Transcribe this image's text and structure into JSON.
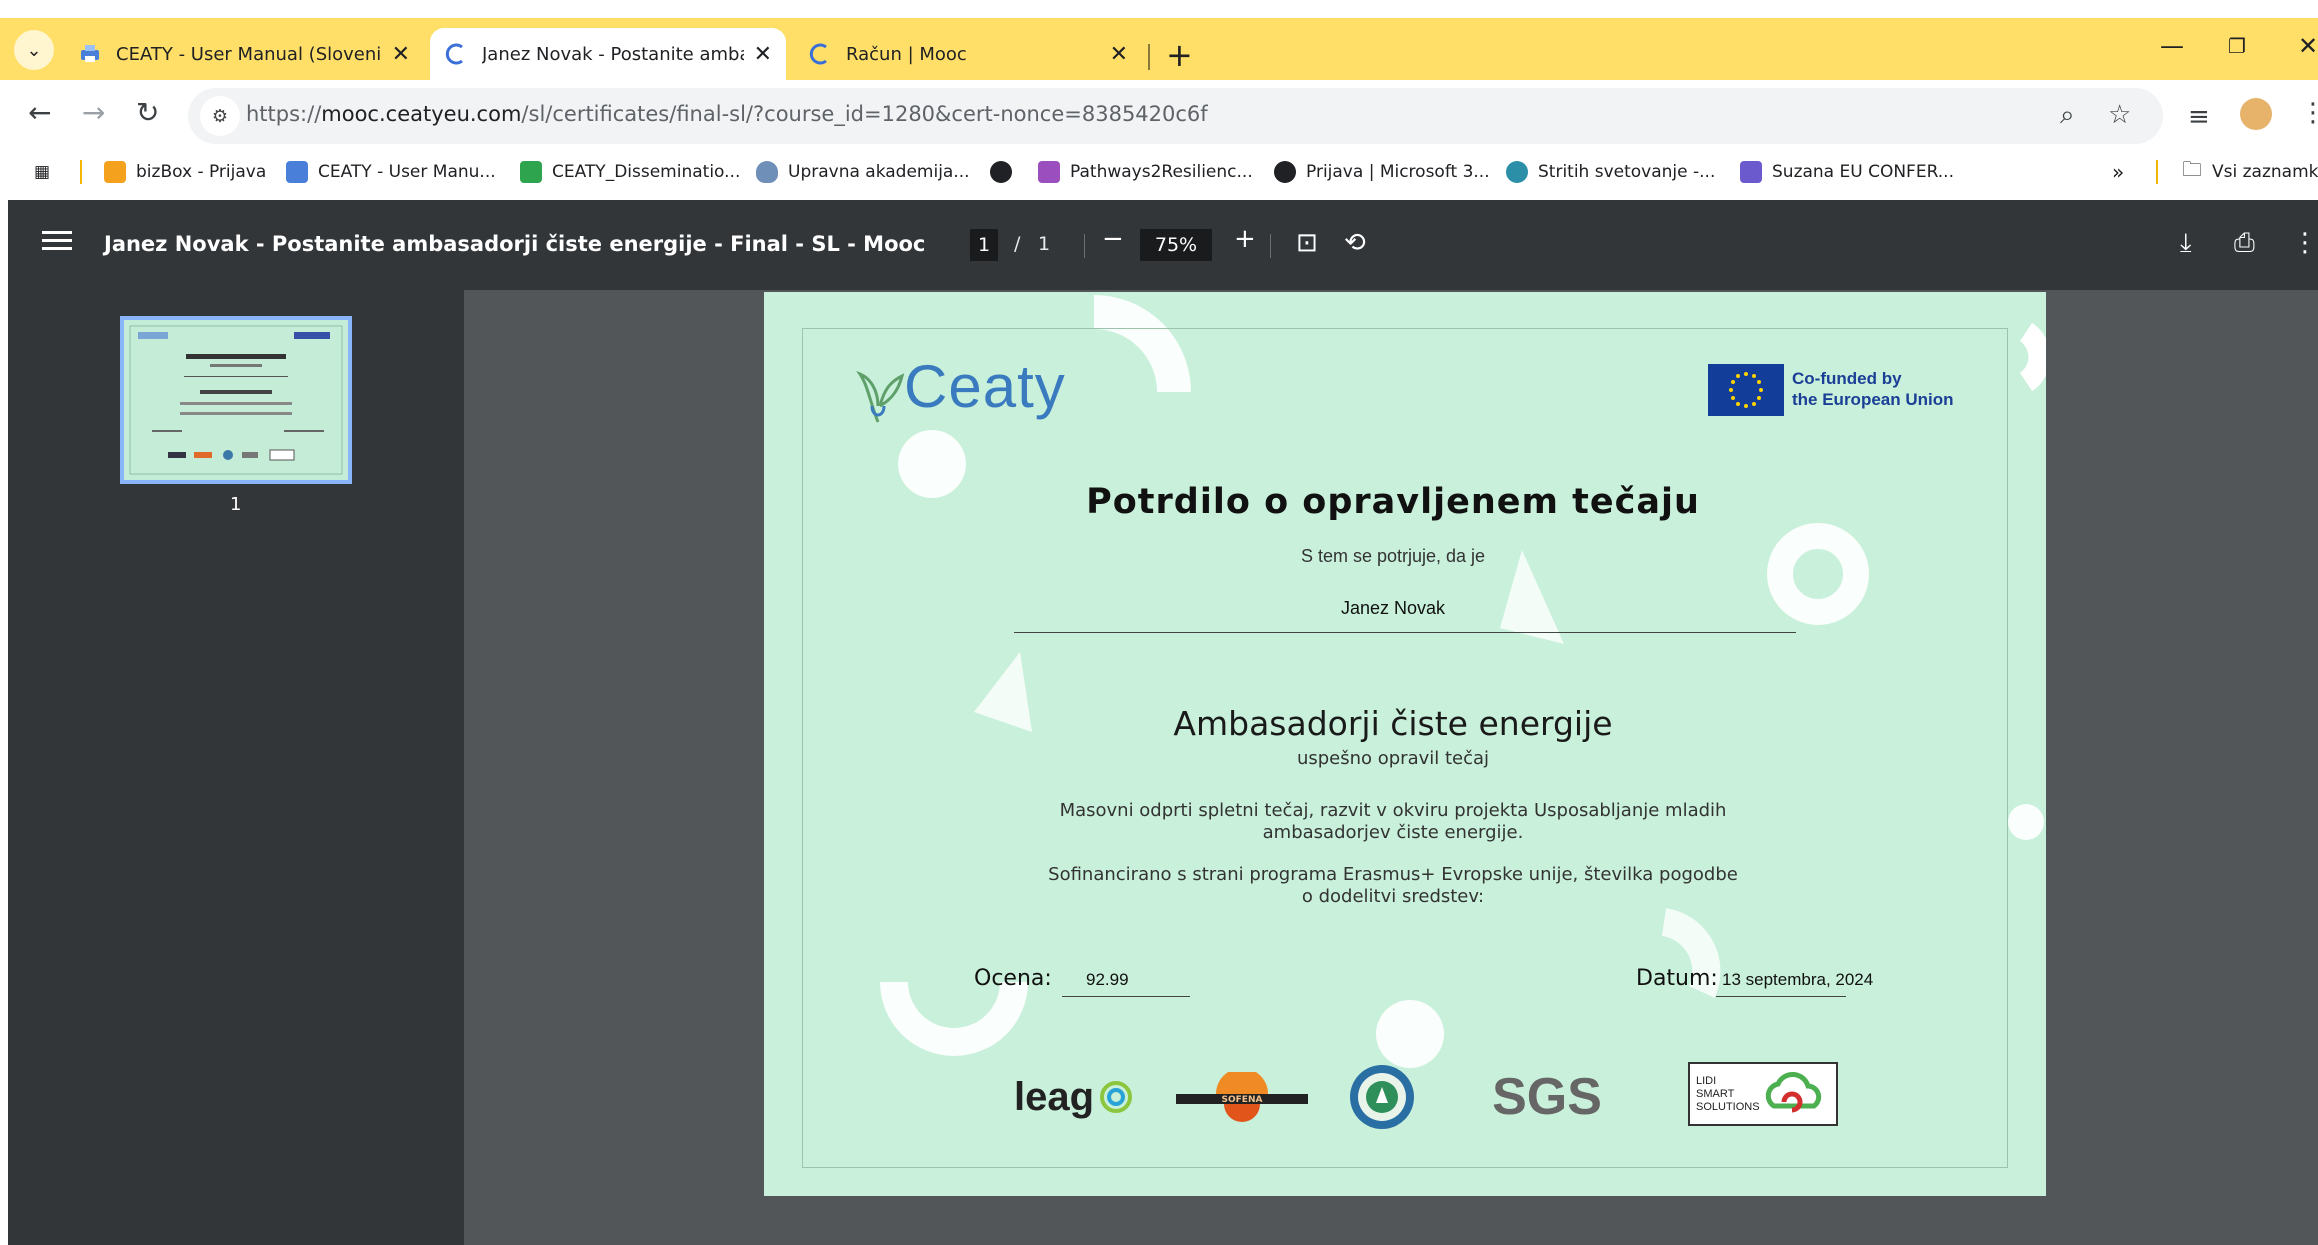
{
  "browser": {
    "tabs": [
      {
        "title": "CEATY - User Manual (Slovenia)",
        "favicon": "printer-icon"
      },
      {
        "title": "Janez Novak - Postanite ambas",
        "favicon": "mooc-c-icon",
        "active": true
      },
      {
        "title": "Račun | Mooc",
        "favicon": "mooc-c-icon"
      }
    ],
    "new_tab": "+",
    "url_prefix": "https://",
    "url_domain": "mooc.ceatyeu.com",
    "url_path": "/sl/certificates/final-sl/?course_id=1280&cert-nonce=8385420c6f",
    "bookmarks": [
      {
        "label": "bizBox - Prijava",
        "color": "#f4a21e"
      },
      {
        "label": "CEATY - User Manu...",
        "color": "#4a7fd9"
      },
      {
        "label": "CEATY_Disseminatio...",
        "color": "#2ea44f"
      },
      {
        "label": "Upravna akademija...",
        "color": "#6f8fb8"
      },
      {
        "label": "",
        "color": "#202124"
      },
      {
        "label": "Pathways2Resilienc...",
        "color": "#9b4fbf"
      },
      {
        "label": "Prijava | Microsoft 3...",
        "color": "#202124"
      },
      {
        "label": "Stritih svetovanje -...",
        "color": "#2b8fa8"
      },
      {
        "label": "Suzana EU CONFER...",
        "color": "#6a5acd"
      }
    ],
    "bookmarks_more": "»",
    "bookmarks_folder": "Vsi zaznamk"
  },
  "pdf": {
    "title": "Janez Novak - Postanite ambasadorji čiste energije - Final - SL - Mooc",
    "page_current": "1",
    "page_sep": "/",
    "page_total": "1",
    "zoom": "75%",
    "thumb_label": "1"
  },
  "certificate": {
    "logo": "Ceaty",
    "eu_line1": "Co-funded by",
    "eu_line2": "the European Union",
    "title": "Potrdilo o opravljenem tečaju",
    "confirm_text": "S tem se potrjuje, da je",
    "name": "Janez Novak",
    "course": "Ambasadorji čiste energije",
    "completed": "uspešno opravil tečaj",
    "desc_line1": "Masovni odprti spletni tečaj, razvit v okviru projekta Usposabljanje mladih",
    "desc_line2": "ambasadorjev čiste energije.",
    "funding_line1": "Sofinancirano s strani programa Erasmus+ Evropske unije, številka pogodbe",
    "funding_line2": "o dodelitvi sredstev:",
    "grade_label": "Ocena:",
    "grade_value": "92.99",
    "date_label": "Datum:",
    "date_value": "13 septembra, 2024",
    "partner_leag": "leag",
    "partner_sofena": "SOFENA",
    "partner_sgs": "SGS",
    "partner_lidi": "LIDI SMART SOLUTIONS"
  }
}
